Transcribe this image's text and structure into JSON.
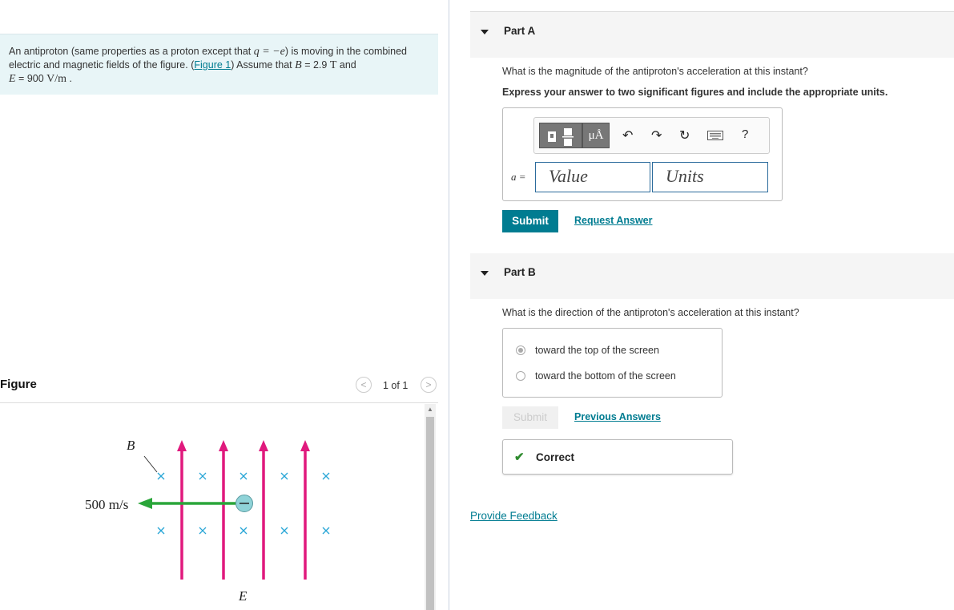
{
  "problem": {
    "text_1": "An antiproton (same properties as a proton except that",
    "q_expr": "q = −e",
    "text_2": ") is moving in the combined electric and magnetic fields of the figure.",
    "figure_link": "Figure 1",
    "text_3": ") Assume that",
    "b_var": "B",
    "b_value": "= 2.9",
    "b_unit": "T",
    "text_4": "and",
    "e_var": "E",
    "e_value": "= 900",
    "e_unit": "V/m",
    "text_end": "."
  },
  "figure": {
    "title": "Figure",
    "counter": "1 of 1",
    "prev_icon": "chevron-left-icon",
    "next_icon": "chevron-right-icon",
    "label_b": "B",
    "label_e": "E",
    "speed_label": "500 m/s",
    "charge_symbol": "−",
    "colors": {
      "field_e": "#e0197d",
      "velocity": "#2aa63a",
      "field_b": "#29a6d6",
      "particle": "#8fd3d8"
    }
  },
  "partA": {
    "title": "Part A",
    "question": "What is the magnitude of the antiproton's acceleration at this instant?",
    "instruction": "Express your answer to two significant figures and include the appropriate units.",
    "toolbar": {
      "template_icon": "fraction-template-icon",
      "units_button": "μÅ",
      "undo_icon": "undo-icon",
      "redo_icon": "redo-icon",
      "reset_icon": "reset-icon",
      "keyboard_icon": "keyboard-icon",
      "help": "?"
    },
    "answer_label": "a =",
    "value_placeholder": "Value",
    "units_placeholder": "Units",
    "submit": "Submit",
    "request_answer": "Request Answer"
  },
  "partB": {
    "title": "Part B",
    "question": "What is the direction of the antiproton's acceleration at this instant?",
    "options": [
      {
        "label": "toward the top of the screen",
        "selected": true
      },
      {
        "label": "toward the bottom of the screen",
        "selected": false
      }
    ],
    "submit": "Submit",
    "previous_answers": "Previous Answers",
    "result": "Correct"
  },
  "feedback": "Provide Feedback"
}
